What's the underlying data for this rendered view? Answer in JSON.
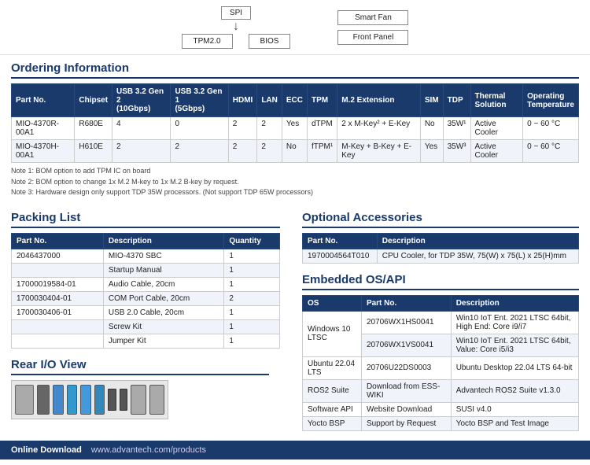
{
  "diagram": {
    "spi_label": "SPI",
    "tpm_label": "TPM2.0",
    "bios_label": "BIOS",
    "smart_fan_label": "Smart Fan",
    "front_panel_label": "Front Panel"
  },
  "ordering": {
    "title": "Ordering Information",
    "headers": [
      "Part No.",
      "Chipset",
      "USB 3.2 Gen 2 (10Gbps)",
      "USB 3.2 Gen 1 (5Gbps)",
      "HDMI",
      "LAN",
      "ECC",
      "TPM",
      "M.2 Extension",
      "SIM",
      "TDP",
      "Thermal Solution",
      "Operating Temperature"
    ],
    "rows": [
      {
        "part_no": "MIO-4370R-00A1",
        "chipset": "R680E",
        "usb32g2": "4",
        "usb32g1": "0",
        "hdmi": "2",
        "lan": "2",
        "ecc": "Yes",
        "tpm": "dTPM",
        "m2ext": "2 x M-Key² + E-Key",
        "sim": "No",
        "tdp": "35W¹",
        "thermal": "Active Cooler",
        "temp": "0 ~ 60 °C"
      },
      {
        "part_no": "MIO-4370H-00A1",
        "chipset": "H610E",
        "usb32g2": "2",
        "usb32g1": "2",
        "hdmi": "2",
        "lan": "2",
        "ecc": "No",
        "tpm": "fTPM¹",
        "m2ext": "M-Key + B-Key + E-Key",
        "sim": "Yes",
        "tdp": "35W³",
        "thermal": "Active Cooler",
        "temp": "0 ~ 60 °C"
      }
    ],
    "notes": [
      "Note 1: BOM option to add TPM IC on board",
      "Note 2: BOM option to change 1x M.2 M-key to 1x M.2 B-key by request.",
      "Note 3: Hardware design only support TDP 35W processors. (Not support TDP 65W processors)"
    ]
  },
  "packing": {
    "title": "Packing List",
    "headers": [
      "Part No.",
      "Description",
      "Quantity"
    ],
    "rows": [
      {
        "part_no": "2046437000",
        "description": "MIO-4370 SBC",
        "qty": "1"
      },
      {
        "part_no": "",
        "description": "Startup Manual",
        "qty": "1"
      },
      {
        "part_no": "17000019584-01",
        "description": "Audio Cable, 20cm",
        "qty": "1"
      },
      {
        "part_no": "1700030404-01",
        "description": "COM Port Cable, 20cm",
        "qty": "2"
      },
      {
        "part_no": "1700030406-01",
        "description": "USB 2.0 Cable, 20cm",
        "qty": "1"
      },
      {
        "part_no": "",
        "description": "Screw Kit",
        "qty": "1"
      },
      {
        "part_no": "",
        "description": "Jumper Kit",
        "qty": "1"
      }
    ]
  },
  "optional": {
    "title": "Optional Accessories",
    "headers": [
      "Part No.",
      "Description"
    ],
    "rows": [
      {
        "part_no": "1970004564T010",
        "description": "CPU Cooler, for TDP 35W, 75(W) x 75(L) x 25(H)mm"
      }
    ]
  },
  "embedded_os": {
    "title": "Embedded OS/API",
    "headers": [
      "OS",
      "Part No.",
      "Description"
    ],
    "rows": [
      {
        "os": "Windows 10 LTSC",
        "part_no": "20706WX1HS0041",
        "description": "Win10 IoT Ent. 2021 LTSC 64bit, High End: Core i9/i7"
      },
      {
        "os": "",
        "part_no": "20706WX1VS0041",
        "description": "Win10 IoT Ent. 2021 LTSC 64bit, Value: Core i5/i3"
      },
      {
        "os": "Ubuntu 22.04 LTS",
        "part_no": "20706U22DS0003",
        "description": "Ubuntu Desktop 22.04 LTS 64-bit"
      },
      {
        "os": "ROS2 Suite",
        "part_no": "Download from ESS-WIKI",
        "description": "Advantech ROS2 Suite v1.3.0"
      },
      {
        "os": "Software API",
        "part_no": "Website Download",
        "description": "SUSI v4.0"
      },
      {
        "os": "Yocto BSP",
        "part_no": "Support by Request",
        "description": "Yocto BSP and Test Image"
      }
    ]
  },
  "rear_io": {
    "title": "Rear I/O View"
  },
  "footer": {
    "label": "Online Download",
    "url": "www.advantech.com/products"
  }
}
